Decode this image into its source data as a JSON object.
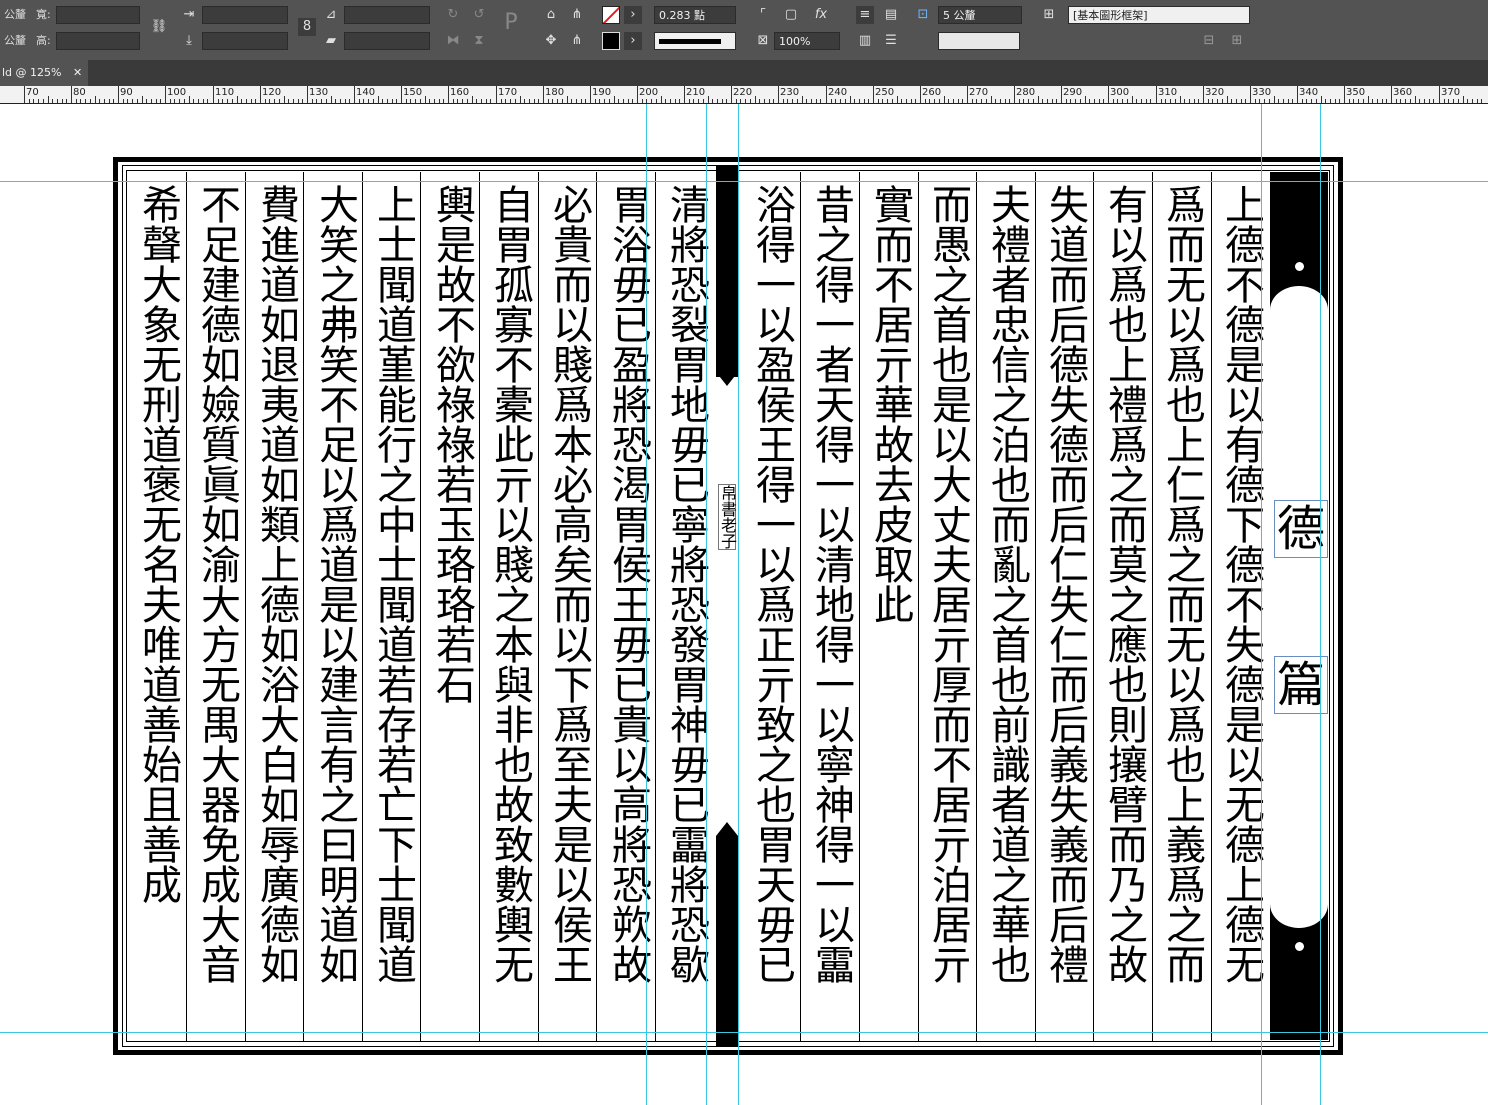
{
  "control_panel": {
    "width_label": "寬:",
    "height_label": "高:",
    "unit_label_1": "公釐",
    "unit_label_2": "公釐",
    "stroke_weight": "0.283 點",
    "opacity": "100%",
    "gap_value": "5 公釐",
    "object_style": "[基本圖形框架]"
  },
  "document_tab": {
    "title": "ld @ 125%",
    "close_icon": "close-icon"
  },
  "ruler": {
    "ticks": [
      "70",
      "80",
      "90",
      "100",
      "110",
      "120",
      "130",
      "140",
      "150",
      "160",
      "170",
      "180",
      "190",
      "200",
      "210",
      "220",
      "230",
      "240",
      "250",
      "260",
      "270",
      "280",
      "290",
      "300",
      "310",
      "320",
      "330",
      "340",
      "350",
      "360",
      "370"
    ]
  },
  "page": {
    "fish_tail_label": "帛書老子",
    "chapter_title": [
      "德",
      "篇"
    ],
    "right_columns": [
      "上德不德是以有德下德不失德是以无德上德无",
      "爲而无以爲也上仁爲之而无以爲也上義爲之而",
      "有以爲也上禮爲之而莫之應也則攘臂而乃之故",
      "失道而后德失德而后仁失仁而后義失義而后禮",
      "夫禮者忠信之泊也而亂之首也前識者道之華也",
      "而愚之首也是以大丈夫居亓厚而不居亓泊居亓",
      "實而不居亓華故去皮取此",
      "昔之得一者天得一以清地得一以寧神得一以靁",
      "浴得一以盈侯王得一以爲正亓致之也胃天毋已"
    ],
    "left_columns": [
      "清將恐裂胃地毋已寧將恐發胃神毋已靁將恐歇",
      "胃浴毋已盈將恐渴胃侯王毋已貴以高將恐欮故",
      "必貴而以賤爲本必高矣而以下爲至夫是以侯王",
      "自胃孤寡不橐此亓以賤之本與非也故致數輿无",
      "輿是故不欲祿祿若玉珞珞若石",
      "上士聞道堇能行之中士聞道若存若亡下士聞道",
      "大笑之弗笑不足以爲道是以建言有之曰明道如",
      "費進道如退夷道如類上德如浴大白如辱廣德如",
      "不足建德如嬐質眞如渝大方无禺大器免成大音",
      "希聲大象无刑道褒无名夫唯道善始且善成"
    ]
  }
}
